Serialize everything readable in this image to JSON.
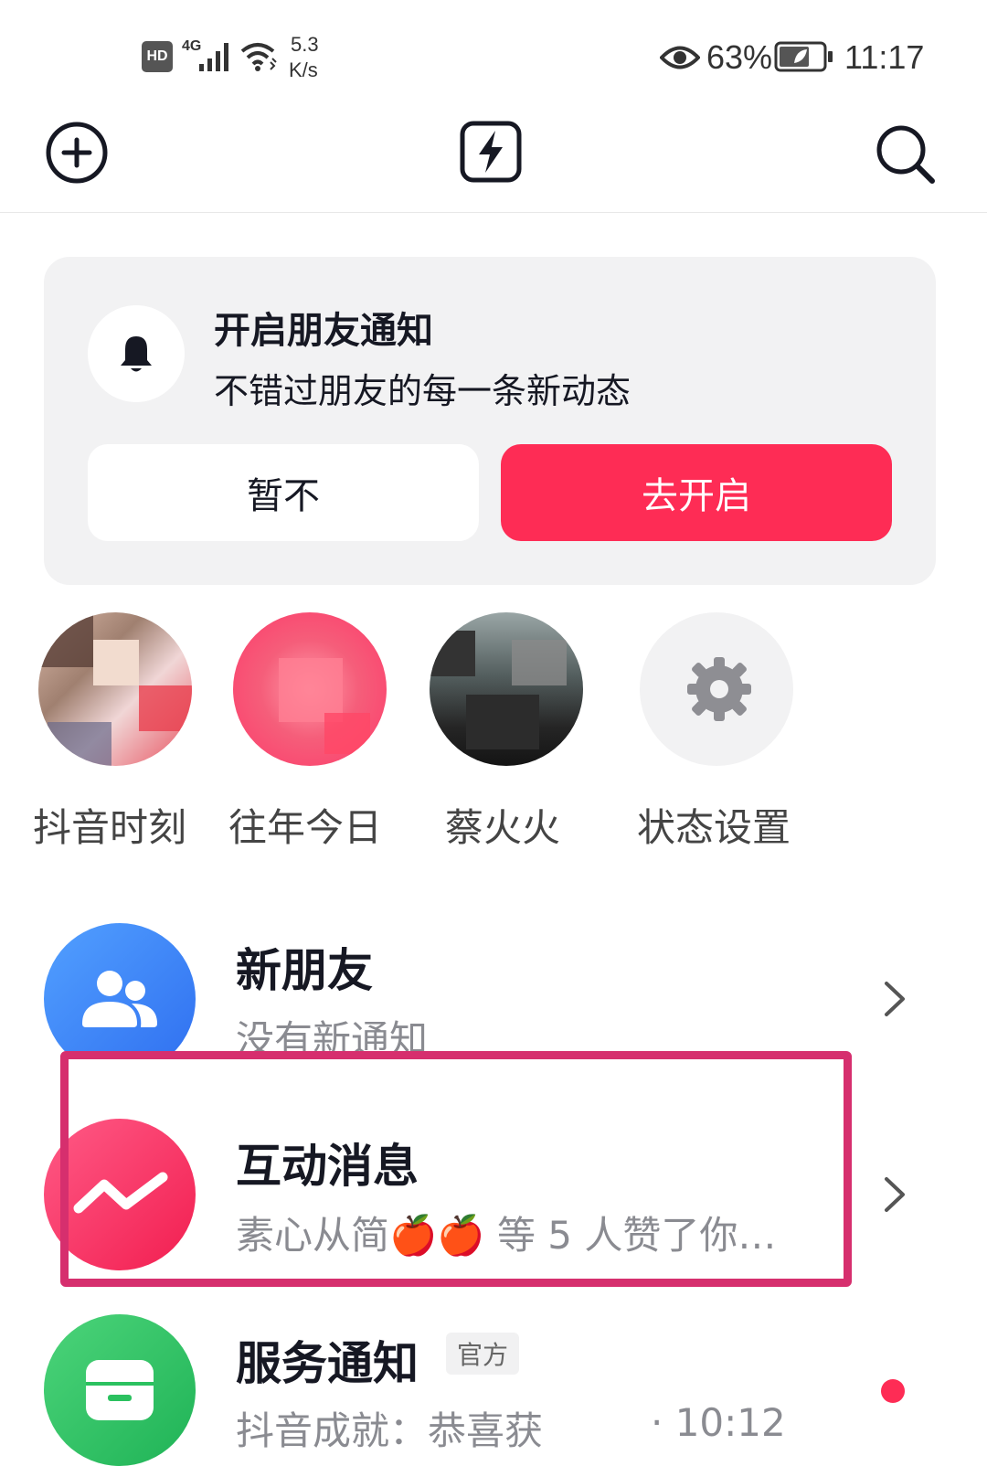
{
  "status_bar": {
    "hd": "HD",
    "network": "4G",
    "speed_value": "5.3",
    "speed_unit": "K/s",
    "battery": "63%",
    "time": "11:17"
  },
  "header": {
    "add_icon": "plus-circle-icon",
    "center_icon": "lightning-icon",
    "search_icon": "search-icon"
  },
  "notice_card": {
    "title": "开启朋友通知",
    "subtitle": "不错过朋友的每一条新动态",
    "decline_label": "暂不",
    "enable_label": "去开启"
  },
  "stories": [
    {
      "label": "抖音时刻"
    },
    {
      "label": "往年今日"
    },
    {
      "label": "蔡火火"
    },
    {
      "label": "状态设置"
    }
  ],
  "list": {
    "new_friends": {
      "title": "新朋友",
      "subtitle": "没有新通知"
    },
    "interactions": {
      "title": "互动消息",
      "subtitle": "素心从简🍎🍎 等 5 人赞了你…"
    },
    "service": {
      "title": "服务通知",
      "badge": "官方",
      "subtitle": "抖音成就：恭喜获",
      "time": "· 10:12"
    }
  },
  "colors": {
    "accent": "#fe2c55",
    "highlight_border": "#d62f6e",
    "friends_blue": "#2f7af5",
    "interaction_pink": "#f5285b",
    "service_green": "#2bc15f",
    "unread_dot": "#fe2c55"
  }
}
